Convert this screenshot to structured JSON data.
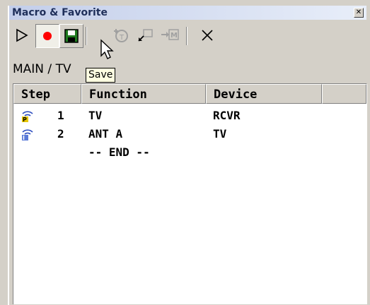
{
  "window": {
    "title": "Macro & Favorite",
    "close_glyph": "✕"
  },
  "toolbar": {
    "buttons": [
      {
        "name": "play-icon"
      },
      {
        "name": "record-icon"
      },
      {
        "name": "save-icon"
      },
      {
        "name": "insert-timer-icon"
      },
      {
        "name": "insert-step-icon"
      },
      {
        "name": "insert-macro-icon"
      },
      {
        "name": "delete-icon"
      }
    ]
  },
  "breadcrumb": "MAIN / TV",
  "tooltip": "Save",
  "table": {
    "columns": [
      "Step",
      "Function",
      "Device"
    ],
    "rows": [
      {
        "step": "1",
        "function": "TV",
        "device": "RCVR",
        "icon": "power-signal-icon"
      },
      {
        "step": "2",
        "function": "ANT A",
        "device": "TV",
        "icon": "input-signal-icon"
      }
    ],
    "end_marker": "-- END --"
  },
  "colors": {
    "record": "#ff0000",
    "save": "#1e7a1e",
    "title_text": "#1f2f5a"
  }
}
